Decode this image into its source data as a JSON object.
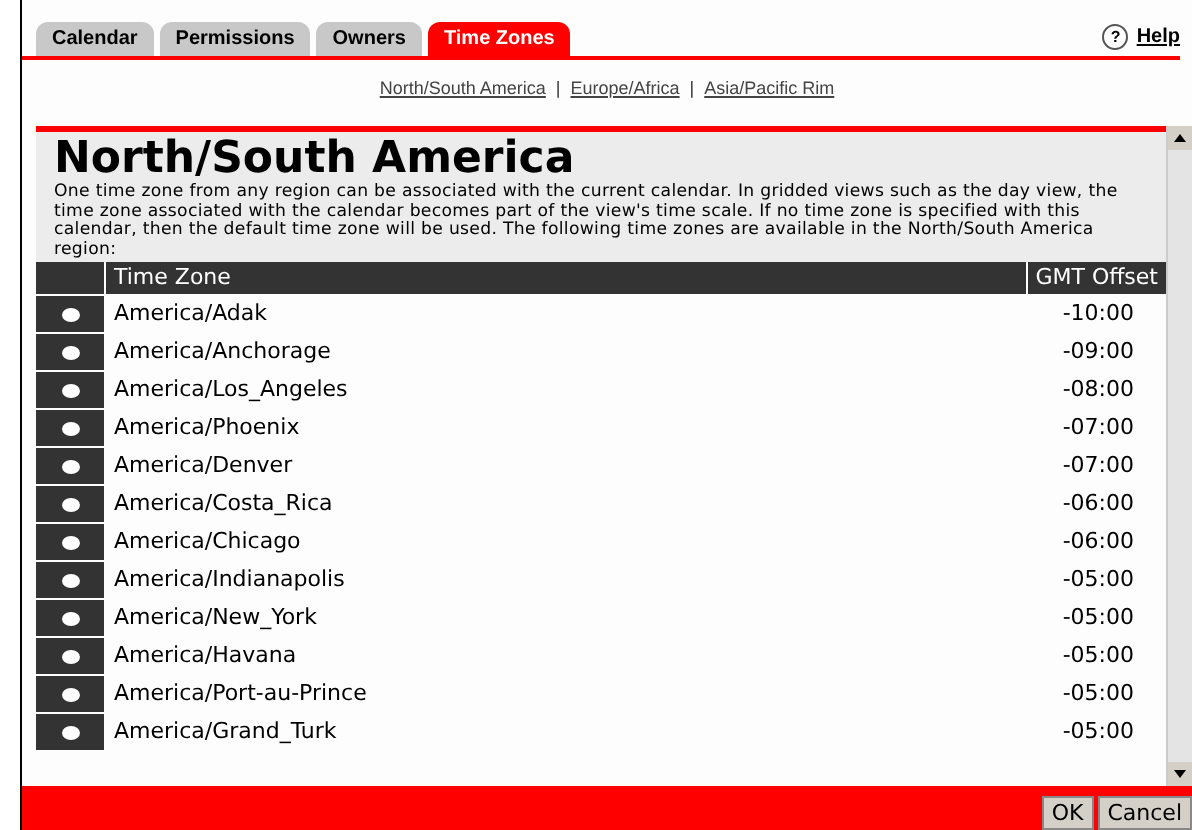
{
  "tabs": [
    {
      "label": "Calendar",
      "selected": false
    },
    {
      "label": "Permissions",
      "selected": false
    },
    {
      "label": "Owners",
      "selected": false
    },
    {
      "label": "Time Zones",
      "selected": true
    }
  ],
  "help": {
    "icon": "?",
    "label": "Help"
  },
  "region_links": [
    {
      "label": "North/South America"
    },
    {
      "label": "Europe/Africa"
    },
    {
      "label": "Asia/Pacific Rim"
    }
  ],
  "link_separator": "|",
  "heading": "North/South America",
  "description": "One time zone from any region can be associated with the current calendar. In gridded views such as the day view, the time zone associated with the calendar becomes part of the view's time scale. If no time zone is specified with this calendar, then the default time zone will be used. The following time zones are available in the North/South America region:",
  "table": {
    "columns": [
      "Time Zone",
      "GMT Offset"
    ],
    "rows": [
      {
        "zone": "America/Adak",
        "offset": "-10:00",
        "selected": false
      },
      {
        "zone": "America/Anchorage",
        "offset": "-09:00",
        "selected": false
      },
      {
        "zone": "America/Los_Angeles",
        "offset": "-08:00",
        "selected": false
      },
      {
        "zone": "America/Phoenix",
        "offset": "-07:00",
        "selected": false
      },
      {
        "zone": "America/Denver",
        "offset": "-07:00",
        "selected": false
      },
      {
        "zone": "America/Costa_Rica",
        "offset": "-06:00",
        "selected": false
      },
      {
        "zone": "America/Chicago",
        "offset": "-06:00",
        "selected": false
      },
      {
        "zone": "America/Indianapolis",
        "offset": "-05:00",
        "selected": false
      },
      {
        "zone": "America/New_York",
        "offset": "-05:00",
        "selected": false
      },
      {
        "zone": "America/Havana",
        "offset": "-05:00",
        "selected": false
      },
      {
        "zone": "America/Port-au-Prince",
        "offset": "-05:00",
        "selected": false
      },
      {
        "zone": "America/Grand_Turk",
        "offset": "-05:00",
        "selected": false
      }
    ]
  },
  "buttons": [
    {
      "label": "OK"
    },
    {
      "label": "Cancel"
    }
  ]
}
